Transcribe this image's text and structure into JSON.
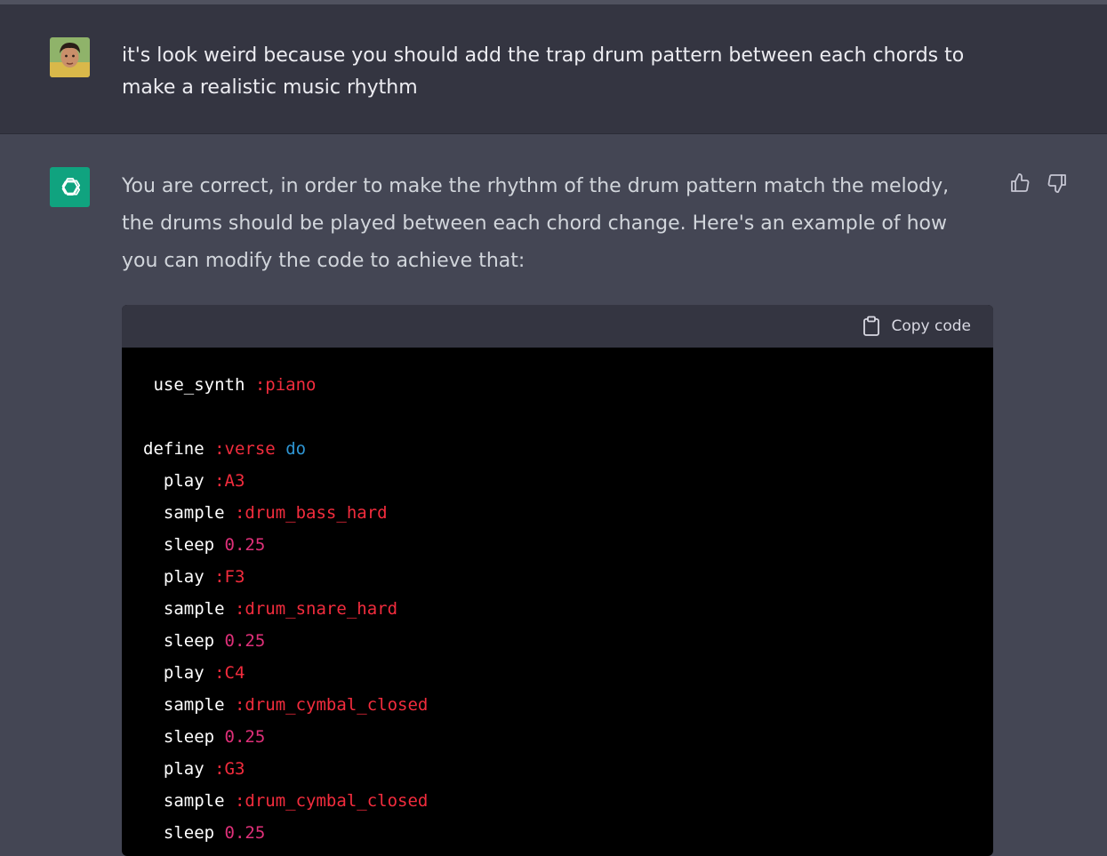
{
  "user_message": {
    "avatar": "user-photo-avatar",
    "text": "it's look weird because you should add the trap drum pattern between each chords to make a realistic music rhythm"
  },
  "assistant_message": {
    "avatar": "openai-logo",
    "text": "You are correct, in order to make the rhythm of the drum pattern match the melody, the drums should be played between each chord change. Here's an example of how you can modify the code to achieve that:",
    "feedback": {
      "thumbs_up": "thumbs-up-icon",
      "thumbs_down": "thumbs-down-icon"
    },
    "code": {
      "copy_label": "Copy code",
      "lines": [
        {
          "indent": " ",
          "a": "use_synth",
          "b": ":piano",
          "c": ""
        },
        {
          "indent": "",
          "a": "",
          "b": "",
          "c": ""
        },
        {
          "indent": "",
          "a": "define",
          "b": ":verse",
          "c": "do"
        },
        {
          "indent": "  ",
          "a": "play",
          "b": ":A3",
          "c": ""
        },
        {
          "indent": "  ",
          "a": "sample",
          "b": ":drum_bass_hard",
          "c": ""
        },
        {
          "indent": "  ",
          "a": "sleep",
          "b": "0.25",
          "c": ""
        },
        {
          "indent": "  ",
          "a": "play",
          "b": ":F3",
          "c": ""
        },
        {
          "indent": "  ",
          "a": "sample",
          "b": ":drum_snare_hard",
          "c": ""
        },
        {
          "indent": "  ",
          "a": "sleep",
          "b": "0.25",
          "c": ""
        },
        {
          "indent": "  ",
          "a": "play",
          "b": ":C4",
          "c": ""
        },
        {
          "indent": "  ",
          "a": "sample",
          "b": ":drum_cymbal_closed",
          "c": ""
        },
        {
          "indent": "  ",
          "a": "sleep",
          "b": "0.25",
          "c": ""
        },
        {
          "indent": "  ",
          "a": "play",
          "b": ":G3",
          "c": ""
        },
        {
          "indent": "  ",
          "a": "sample",
          "b": ":drum_cymbal_closed",
          "c": ""
        },
        {
          "indent": "  ",
          "a": "sleep",
          "b": "0.25",
          "c": ""
        }
      ]
    }
  },
  "colors": {
    "user_bg": "#343541",
    "assistant_bg": "#444654",
    "accent": "#10a37f",
    "code_symbol": "#f22c3d",
    "code_number": "#df3079",
    "code_keyword": "#2e95d3"
  }
}
